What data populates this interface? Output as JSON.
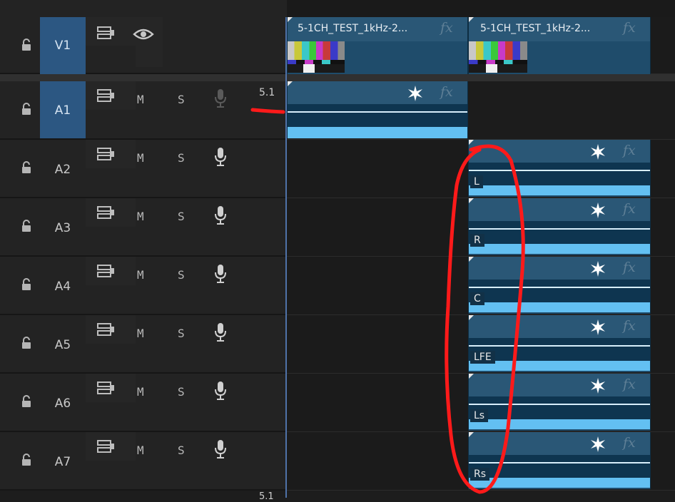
{
  "tracks": {
    "v1": {
      "name": "V1"
    },
    "a1": {
      "name": "A1",
      "mute": "M",
      "solo": "S",
      "channel_badge": "5.1"
    },
    "audio": [
      {
        "name": "A2",
        "mute": "M",
        "solo": "S",
        "channel": "L"
      },
      {
        "name": "A3",
        "mute": "M",
        "solo": "S",
        "channel": "R"
      },
      {
        "name": "A4",
        "mute": "M",
        "solo": "S",
        "channel": "C"
      },
      {
        "name": "A5",
        "mute": "M",
        "solo": "S",
        "channel": "LFE"
      },
      {
        "name": "A6",
        "mute": "M",
        "solo": "S",
        "channel": "Ls"
      },
      {
        "name": "A7",
        "mute": "M",
        "solo": "S",
        "channel": "Rs"
      }
    ],
    "bottom_badge": "5.1"
  },
  "video_clips": [
    {
      "title": "5-1CH_TEST_1kHz-2...",
      "fx": "fx"
    },
    {
      "title": "5-1CH_TEST_1kHz-2...",
      "fx": "fx"
    }
  ],
  "a1_clip": {
    "fx": "fx"
  },
  "audio_clip_fx": "fx",
  "colors": {
    "selected_track": "#2c5782",
    "clip_body": "#1f4c6b",
    "waveform": "#63c0f2",
    "playhead": "#4f72a8",
    "annotation": "#ff1a1a"
  }
}
